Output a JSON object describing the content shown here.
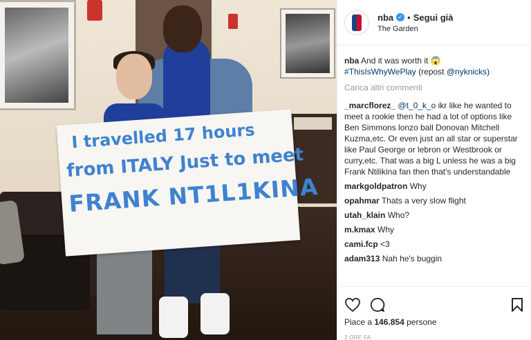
{
  "post": {
    "username": "nba",
    "follow_status": "Segui già",
    "location": "The Garden",
    "colors": {
      "link": "#003569",
      "verified": "#3897f0",
      "muted": "#999999"
    }
  },
  "photo": {
    "banner_lines": [
      "I travelled 17 hours",
      "from ITALY Just to meet",
      "FRANK NT1L1KINA"
    ]
  },
  "caption": {
    "username": "nba",
    "text": "And it was worth it 😱",
    "hashtag": "#ThisIsWhyWePlay",
    "repost_prefix": "(repost",
    "mention": "@nyknicks",
    "repost_suffix": ")"
  },
  "load_more": "Carica altri commenti",
  "comments": [
    {
      "username": "_marcflorez_",
      "mention": "@t_0_k_o",
      "text": "ikr like he wanted to meet a rookie then he had a lot of options like Ben Simmons lonzo ball Donovan Mitchell Kuzma,etc. Or even just an all star or superstar like Paul George or lebron or Westbrook or curry,etc. That was a big L unless he was a big Frank Ntilikina fan then that's understandable"
    },
    {
      "username": "markgoldpatron",
      "text": "Why"
    },
    {
      "username": "opahmar",
      "text": "Thats a very slow flight"
    },
    {
      "username": "utah_klain",
      "text": "Who?"
    },
    {
      "username": "m.kmax",
      "text": "Why"
    },
    {
      "username": "cami.fcp",
      "text": "<3"
    },
    {
      "username": "adam313",
      "text": "Nah he's buggin"
    }
  ],
  "likes": {
    "prefix": "Piace a",
    "count": "146.854",
    "suffix": "persone"
  },
  "timestamp": "2 ORE FA",
  "icons": [
    "heart-icon",
    "comment-icon",
    "bookmark-icon",
    "verified-icon"
  ]
}
